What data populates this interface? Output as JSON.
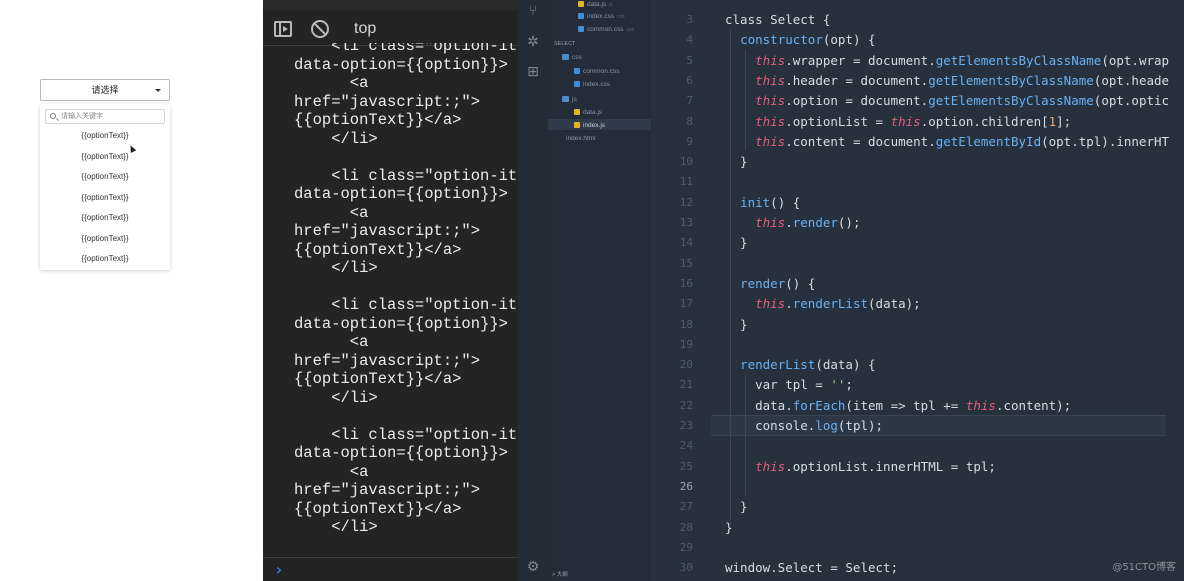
{
  "page": {
    "select_label": "请选择",
    "search_placeholder": "请输入关键字",
    "options": [
      "{{optionText}}",
      "{{optionText}}",
      "{{optionText}}",
      "{{optionText}}",
      "{{optionText}}",
      "{{optionText}}",
      "{{optionText}}"
    ]
  },
  "devtools": {
    "context": "top",
    "console_lines": [
      "    <li class=\"option-it",
      "data-option={{option}}>",
      "      <a",
      "href=\"javascript:;\">",
      "{{optionText}}</a>",
      "    </li>",
      "",
      "    <li class=\"option-it",
      "data-option={{option}}>",
      "      <a",
      "href=\"javascript:;\">",
      "{{optionText}}</a>",
      "    </li>",
      "",
      "    <li class=\"option-it",
      "data-option={{option}}>",
      "      <a",
      "href=\"javascript:;\">",
      "{{optionText}}</a>",
      "    </li>",
      "",
      "    <li class=\"option-it",
      "data-option={{option}}>",
      "      <a",
      "href=\"javascript:;\">",
      "{{optionText}}</a>",
      "    </li>"
    ]
  },
  "explorer": {
    "items": [
      {
        "label": "data.js",
        "icon": "js",
        "badge": "js"
      },
      {
        "label": "index.css",
        "icon": "css",
        "badge": "css"
      },
      {
        "label": "common.css",
        "icon": "css",
        "badge": "css"
      },
      {
        "label": "SELECT",
        "icon": "section",
        "badge": ""
      },
      {
        "label": "css",
        "icon": "folder",
        "badge": ""
      },
      {
        "label": "common.css",
        "icon": "css",
        "badge": ""
      },
      {
        "label": "index.css",
        "icon": "css",
        "badge": ""
      },
      {
        "label": "js",
        "icon": "folder",
        "badge": ""
      },
      {
        "label": "data.js",
        "icon": "js",
        "badge": ""
      },
      {
        "label": "index.js",
        "icon": "js",
        "badge": ""
      },
      {
        "label": "index.html",
        "icon": "html",
        "badge": ""
      },
      {
        "label": "> 大纲",
        "icon": "section",
        "badge": ""
      }
    ],
    "active_item": "index.js"
  },
  "editor": {
    "line_numbers": [
      "3",
      "4",
      "5",
      "6",
      "7",
      "8",
      "9",
      "10",
      "11",
      "12",
      "13",
      "14",
      "15",
      "16",
      "17",
      "18",
      "19",
      "20",
      "21",
      "22",
      "23",
      "24",
      "25",
      "26",
      "27",
      "28",
      "29",
      "30"
    ],
    "code_lines": [
      "class Select {",
      "  constructor(opt) {",
      "    this.wrapper = document.getElementsByClassName(opt.wrap",
      "    this.header = document.getElementsByClassName(opt.heade",
      "    this.option = document.getElementsByClassName(opt.optic",
      "    this.optionList = this.option.children[1];",
      "    this.content = document.getElementById(opt.tpl).innerHT",
      "  }",
      "",
      "  init() {",
      "    this.render();",
      "  }",
      "",
      "  render() {",
      "    this.renderList(data);",
      "  }",
      "",
      "  renderList(data) {",
      "    var tpl = '';",
      "    data.forEach(item => tpl += this.content);",
      "    console.log(tpl);",
      "",
      "    this.optionList.innerHTML = tpl;",
      "",
      "  }",
      "}",
      "",
      "window.Select = Select;"
    ],
    "current_line": "26"
  },
  "watermark": "@51CTO博客"
}
